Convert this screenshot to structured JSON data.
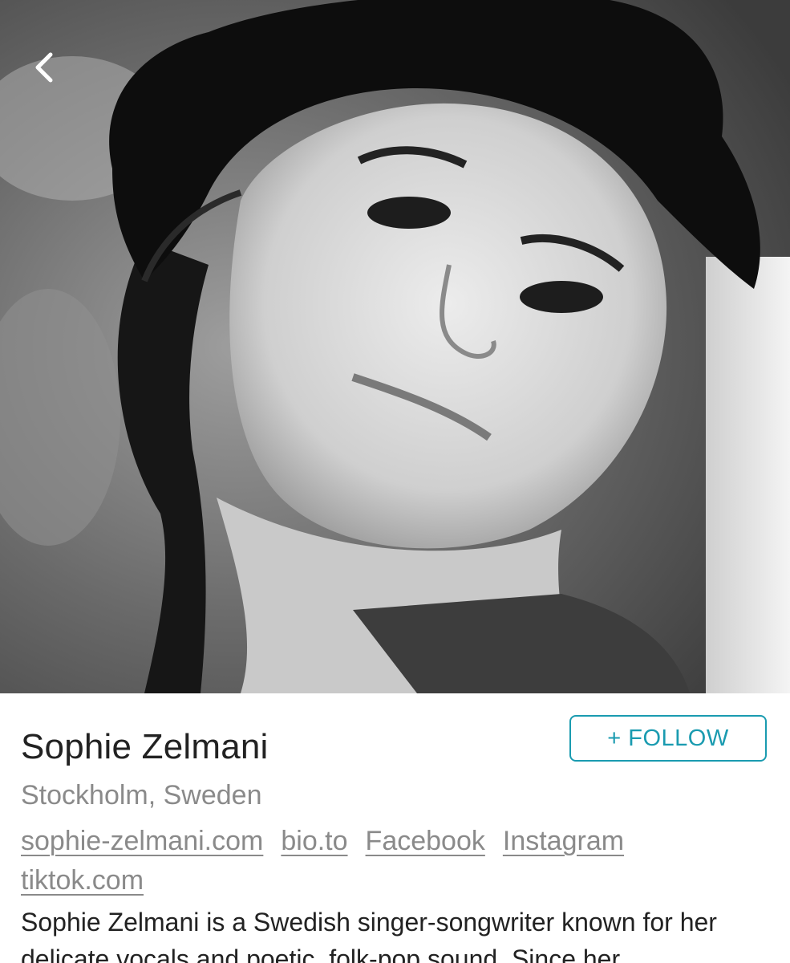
{
  "navigation": {
    "back_icon": "chevron-left-icon"
  },
  "hero": {
    "image_alt": "black-and-white portrait photo",
    "photo_tones": {
      "background": "#7a7a7a",
      "hat": "#0d0d0d",
      "skin": "#d6d6d6",
      "hair": "#1a1a1a"
    }
  },
  "artist": {
    "name": "Sophie Zelmani",
    "location": "Stockholm, Sweden",
    "follow_label": "+ FOLLOW",
    "links": [
      "sophie-zelmani.com",
      "bio.to",
      "Facebook",
      "Instagram",
      "tiktok.com"
    ],
    "bio": "Sophie Zelmani is a Swedish singer-songwriter known for her delicate vocals and poetic, folk-pop sound. Since her"
  },
  "colors": {
    "accent": "#1a9bb0",
    "muted_text": "#8a8a8a",
    "body_text": "#222222"
  }
}
